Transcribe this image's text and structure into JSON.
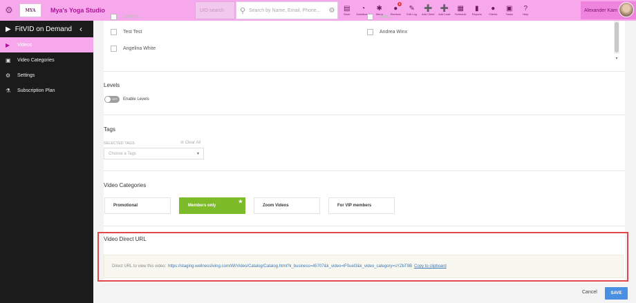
{
  "topbar": {
    "studio_name": "Mya's Yoga Studio",
    "logo_text": "MYA",
    "uid_placeholder": "UID search",
    "search_placeholder": "Search by Name, Email, Phone...",
    "nav": [
      {
        "label": "Store",
        "icon": "store-icon",
        "glyph": "▤"
      },
      {
        "label": "Dashboard",
        "icon": "dashboard-icon",
        "glyph": "◔"
      },
      {
        "label": "Setup",
        "icon": "setup-icon",
        "glyph": "✱"
      },
      {
        "label": "Reviews",
        "icon": "reviews-icon",
        "glyph": "●",
        "badge": "6"
      },
      {
        "label": "Edit Log",
        "icon": "edit-log-icon",
        "glyph": "✎"
      },
      {
        "label": "Add Client",
        "icon": "add-client-icon",
        "glyph": "➕"
      },
      {
        "label": "Add Lead",
        "icon": "add-lead-icon",
        "glyph": "➕"
      },
      {
        "label": "Schedule",
        "icon": "schedule-icon",
        "glyph": "▦"
      },
      {
        "label": "Reports",
        "icon": "reports-icon",
        "glyph": "▮"
      },
      {
        "label": "Clients",
        "icon": "clients-icon",
        "glyph": "●"
      },
      {
        "label": "Tasks",
        "icon": "tasks-icon",
        "glyph": "▣"
      },
      {
        "label": "Help",
        "icon": "help-icon",
        "glyph": "?"
      }
    ],
    "user_name": "Alexander Kam"
  },
  "sidebar": {
    "title": "FitVID on Demand",
    "items": [
      {
        "label": "Videos",
        "icon": "videos-icon",
        "active": true
      },
      {
        "label": "Video Categories",
        "icon": "video-categories-icon",
        "active": false
      },
      {
        "label": "Settings",
        "icon": "settings-icon",
        "active": false
      },
      {
        "label": "Subscription Plan",
        "icon": "subscription-plan-icon",
        "active": false
      }
    ]
  },
  "members": {
    "left": [
      "Test Test",
      "Angelina White"
    ],
    "right": [
      "Andrea Winx"
    ]
  },
  "levels": {
    "title": "Levels",
    "toggle_state": "OFF",
    "toggle_label": "Enable Levels"
  },
  "tags": {
    "title": "Tags",
    "selected_label": "SELECTED TAGS",
    "clear_all": "Clear All",
    "placeholder": "Choose a Tags"
  },
  "video_categories": {
    "title": "Video Categories",
    "items": [
      {
        "label": "Promotional",
        "selected": false
      },
      {
        "label": "Members only",
        "selected": true
      },
      {
        "label": "Zoom Videos",
        "selected": false
      },
      {
        "label": "For VIP members",
        "selected": false
      }
    ]
  },
  "direct_url": {
    "title": "Video Direct URL",
    "prefix": "Direct URL to view this video:",
    "url": "https://staging.wellnessliving.com/Wl/Video/Catalog/Catalog.html?k_business=45707&k_video=lF0uel3&k_video_category=sYZbT9B",
    "copy": "Copy to clipboard"
  },
  "footer": {
    "cancel": "Cancel",
    "save": "SAVE"
  },
  "colors": {
    "brand_pink": "#f7a8ec",
    "brand_magenta": "#b0109b",
    "selected_green": "#7dbb29",
    "save_blue": "#4a90e2",
    "highlight_red": "#e0474a"
  }
}
